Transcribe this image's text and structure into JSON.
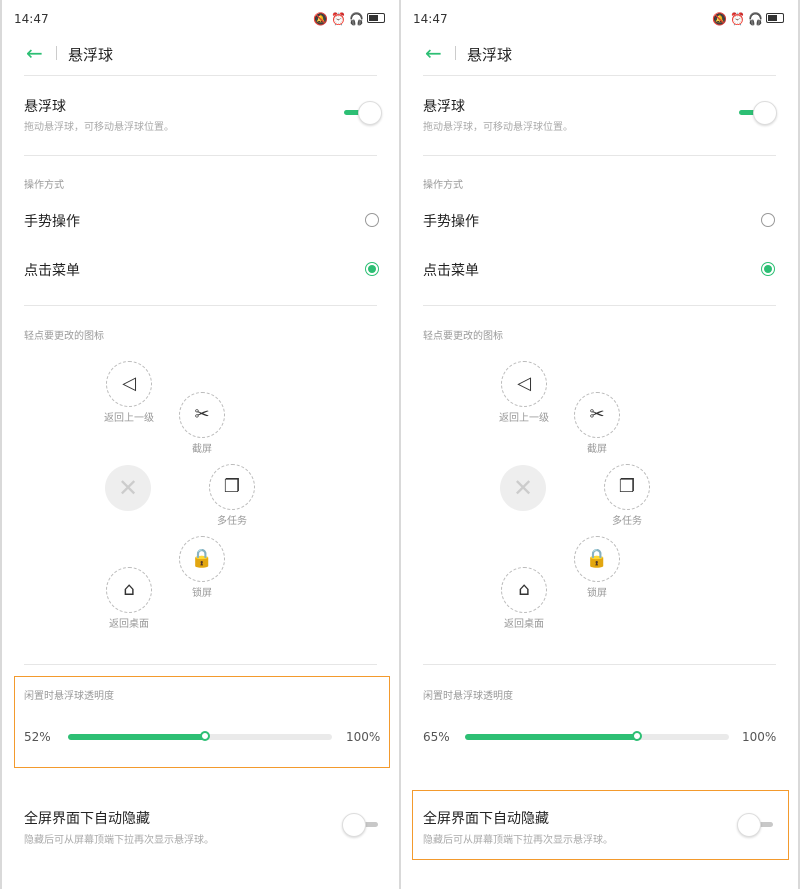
{
  "panels": [
    {
      "status": {
        "time": "14:47",
        "signal": "ᵢₗ",
        "wifi": "≋"
      },
      "title": "悬浮球",
      "float_ball": {
        "label": "悬浮球",
        "desc": "拖动悬浮球，可移动悬浮球位置。",
        "enabled": true
      },
      "op_section": "操作方式",
      "op_gesture": {
        "label": "手势操作",
        "selected": false
      },
      "op_menu": {
        "label": "点击菜单",
        "selected": true
      },
      "icons_section": "轻点要更改的图标",
      "icons": {
        "back": {
          "glyph": "◁",
          "label": "返回上一级"
        },
        "screenshot": {
          "glyph": "✂",
          "label": "截屏"
        },
        "close": {
          "glyph": "✕"
        },
        "multitask": {
          "glyph": "❐",
          "label": "多任务"
        },
        "lock": {
          "glyph": "🔒",
          "label": "锁屏"
        },
        "home": {
          "glyph": "⌂",
          "label": "返回桌面"
        }
      },
      "opacity": {
        "label": "闲置时悬浮球透明度",
        "value": 52,
        "min_text": "52%",
        "max_text": "100%"
      },
      "auto_hide": {
        "label": "全屏界面下自动隐藏",
        "desc": "隐藏后可从屏幕顶端下拉再次显示悬浮球。",
        "enabled": false
      }
    },
    {
      "status": {
        "time": "14:47",
        "signal": "ᵢₗ",
        "wifi": "≋"
      },
      "title": "悬浮球",
      "float_ball": {
        "label": "悬浮球",
        "desc": "拖动悬浮球，可移动悬浮球位置。",
        "enabled": true
      },
      "op_section": "操作方式",
      "op_gesture": {
        "label": "手势操作",
        "selected": false
      },
      "op_menu": {
        "label": "点击菜单",
        "selected": true
      },
      "icons_section": "轻点要更改的图标",
      "icons": {
        "back": {
          "glyph": "◁",
          "label": "返回上一级"
        },
        "screenshot": {
          "glyph": "✂",
          "label": "截屏"
        },
        "close": {
          "glyph": "✕"
        },
        "multitask": {
          "glyph": "❐",
          "label": "多任务"
        },
        "lock": {
          "glyph": "🔒",
          "label": "锁屏"
        },
        "home": {
          "glyph": "⌂",
          "label": "返回桌面"
        }
      },
      "opacity": {
        "label": "闲置时悬浮球透明度",
        "value": 65,
        "min_text": "65%",
        "max_text": "100%"
      },
      "auto_hide": {
        "label": "全屏界面下自动隐藏",
        "desc": "隐藏后可从屏幕顶端下拉再次显示悬浮球。",
        "enabled": false
      }
    }
  ],
  "colors": {
    "accent": "#2dbf74",
    "highlight": "#f39a2d"
  }
}
